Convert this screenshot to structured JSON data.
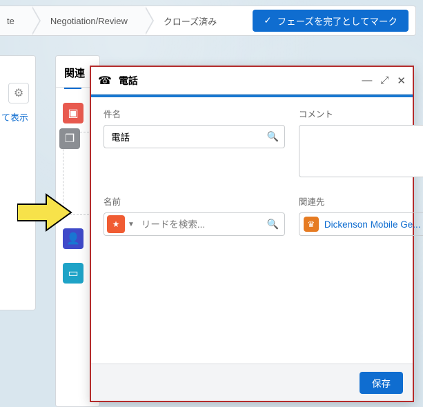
{
  "path": {
    "stages": [
      "te",
      "Negotiation/Review",
      "クローズ済み"
    ],
    "complete_button": "フェーズを完了としてマーク"
  },
  "leftPanel": {
    "link_text": "て表示"
  },
  "midPanel": {
    "header": "関連"
  },
  "modal": {
    "title": "電話",
    "subject_label": "件名",
    "subject_value": "電話",
    "comment_label": "コメント",
    "comment_value": "",
    "name_label": "名前",
    "name_placeholder": "リードを検索...",
    "related_label": "関連先",
    "related_chip_text": "Dickenson Mobile Ge...",
    "save_label": "保存"
  },
  "icons": {
    "phone": "☎",
    "search": "🔍",
    "gear": "⚙",
    "minimize": "—",
    "expand": "⤢",
    "close": "✕",
    "check": "✓",
    "star": "★",
    "crown": "♛",
    "bag": "▣",
    "copy": "❐",
    "person": "👤",
    "cal": "▭"
  },
  "colors": {
    "tile_task": "#e85a4f",
    "tile_copy": "#8b8e93",
    "tile_person": "#3f4ac9",
    "tile_cal": "#1ea3c7"
  }
}
